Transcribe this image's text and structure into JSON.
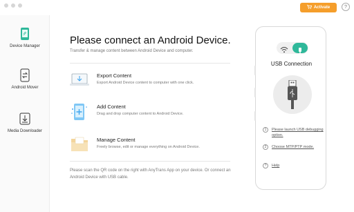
{
  "header": {
    "activate_label": "Activate",
    "help_label": "?"
  },
  "sidebar": {
    "items": [
      {
        "label": "Device Manager",
        "icon": "phone-icon",
        "active": true
      },
      {
        "label": "Android Mover",
        "icon": "transfer-phone-icon",
        "active": false
      },
      {
        "label": "Media Downloader",
        "icon": "download-icon",
        "active": false
      }
    ]
  },
  "main": {
    "title": "Please connect an Android Device.",
    "subtitle": "Transfer & manage content between Android Device and computer.",
    "features": [
      {
        "title": "Export Content",
        "description": "Export Android Device content to computer with one click.",
        "icon": "laptop-export-icon"
      },
      {
        "title": "Add Content",
        "description": "Drag and drop computer content to Android Device.",
        "icon": "add-content-icon"
      },
      {
        "title": "Manage Content",
        "description": "Freely browse, edit or manage everything on Android Device.",
        "icon": "folder-icon"
      }
    ],
    "note": "Please scan the QR code on the right with AnyTrans App on your device. Or connect an Android Device with USB cable."
  },
  "phone_panel": {
    "title": "USB Connection",
    "steps": [
      {
        "num": "1",
        "text": "Please launch USB debugging option."
      },
      {
        "num": "2",
        "text": "Choose MTP/PTP mode."
      },
      {
        "num": "?",
        "text": "Help"
      }
    ]
  },
  "colors": {
    "accent": "#f59e2b",
    "toggle": "#2fb89a",
    "phone_icon": "#2fb89a",
    "feature_blue": "#41a5ef"
  }
}
